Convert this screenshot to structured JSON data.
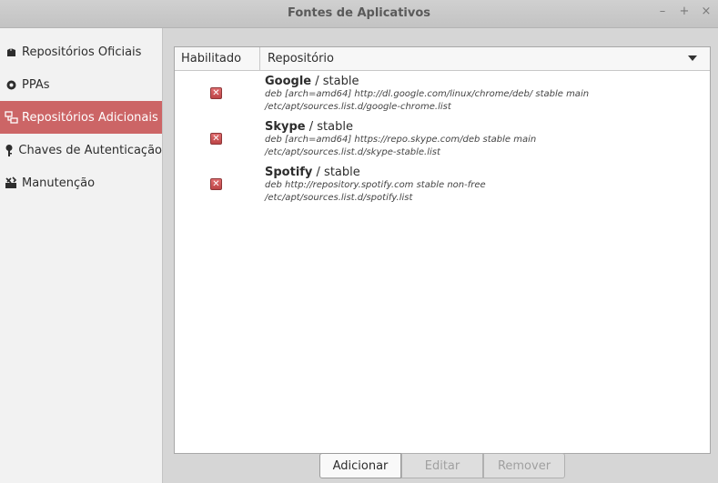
{
  "window": {
    "title": "Fontes de Aplicativos",
    "controls": {
      "minimize": "–",
      "maximize": "+",
      "close": "×"
    }
  },
  "sidebar": {
    "items": [
      {
        "label": "Repositórios Oficiais",
        "icon": "package-icon"
      },
      {
        "label": "PPAs",
        "icon": "ppa-icon"
      },
      {
        "label": "Repositórios Adicionais",
        "icon": "network-icon",
        "active": true
      },
      {
        "label": "Chaves de Autenticação",
        "icon": "key-icon"
      },
      {
        "label": "Manutenção",
        "icon": "maintenance-icon"
      }
    ]
  },
  "table": {
    "columns": [
      "Habilitado",
      "Repositório"
    ],
    "rows": [
      {
        "name": "Google",
        "suffix": " / stable",
        "line1": "deb [arch=amd64] http://dl.google.com/linux/chrome/deb/ stable main",
        "line2": "/etc/apt/sources.list.d/google-chrome.list",
        "enabled": false
      },
      {
        "name": "Skype",
        "suffix": " / stable",
        "line1": "deb [arch=amd64] https://repo.skype.com/deb stable main",
        "line2": "/etc/apt/sources.list.d/skype-stable.list",
        "enabled": false
      },
      {
        "name": "Spotify",
        "suffix": " / stable",
        "line1": "deb http://repository.spotify.com stable non-free",
        "line2": "/etc/apt/sources.list.d/spotify.list",
        "enabled": false
      }
    ]
  },
  "buttons": {
    "add": "Adicionar",
    "edit": "Editar",
    "remove": "Remover"
  },
  "colors": {
    "accent": "#cc6566",
    "checkbox": "#c9484a"
  }
}
